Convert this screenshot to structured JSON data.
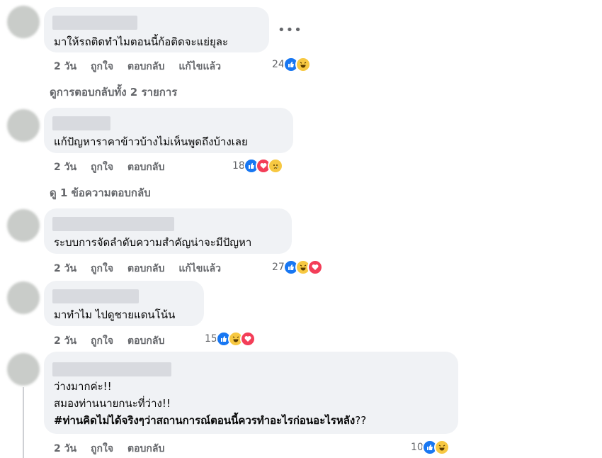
{
  "comments": [
    {
      "text": "มาให้รถติดทำไมตอนนี้ก้อติดจะแย่ยุละ",
      "actions": {
        "time": "2 วัน",
        "like": "ถูกใจ",
        "reply": "ตอบกลับ",
        "edited": "แก้ไขแล้ว"
      },
      "reaction_count": "24",
      "reactions": [
        "like",
        "haha"
      ]
    },
    {
      "text": "แก้ปัญหาราคาข้าวบ้างไม่เห็นพูดถึงบ้างเลย",
      "actions": {
        "time": "2 วัน",
        "like": "ถูกใจ",
        "reply": "ตอบกลับ"
      },
      "reaction_count": "18",
      "reactions": [
        "like",
        "love",
        "sad"
      ]
    },
    {
      "text": "ระบบการจัดลำดับความสำคัญน่าจะมีปัญหา",
      "actions": {
        "time": "2 วัน",
        "like": "ถูกใจ",
        "reply": "ตอบกลับ",
        "edited": "แก้ไขแล้ว"
      },
      "reaction_count": "27",
      "reactions": [
        "like",
        "haha",
        "love"
      ]
    },
    {
      "text": "มาทำไม ไปดูชายแดนโน้น",
      "actions": {
        "time": "2 วัน",
        "like": "ถูกใจ",
        "reply": "ตอบกลับ"
      },
      "reaction_count": "15",
      "reactions": [
        "like",
        "haha",
        "love"
      ]
    },
    {
      "lines": [
        "ว่างมากค่ะ!!",
        "สมองท่านนายกนะที่ว่าง!!",
        "#ท่านคิดไม่ได้จริงๆว่าสถานการณ์ตอนนี้ควรทำอะไรก่อนอะไรหลัง",
        "??"
      ],
      "actions": {
        "time": "2 วัน",
        "like": "ถูกใจ",
        "reply": "ตอบกลับ"
      },
      "reaction_count": "10",
      "reactions": [
        "like",
        "haha"
      ]
    }
  ],
  "view_replies": [
    "ดูการตอบกลับทั้ง 2 รายการ",
    "ดู 1 ข้อความตอบกลับ"
  ],
  "more_icon": "•••"
}
